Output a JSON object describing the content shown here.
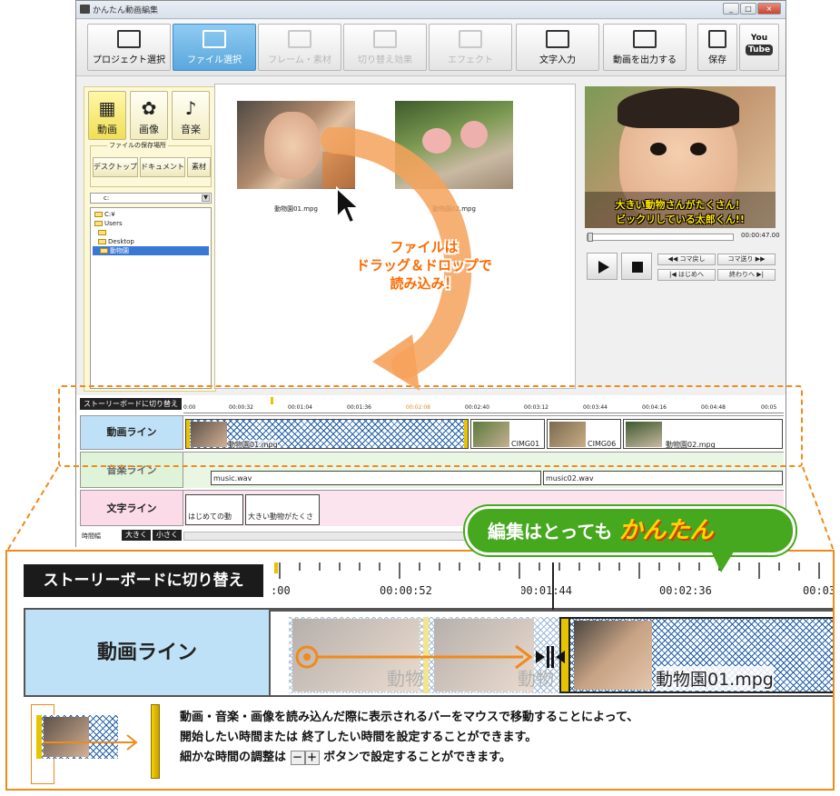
{
  "window": {
    "title": "かんたん動画編集",
    "controls": [
      "_",
      "□",
      "×"
    ]
  },
  "toolbar": {
    "project": "プロジェクト選択",
    "file": "ファイル選択",
    "frame": "フレーム・素材",
    "transition": "切り替え効果",
    "effect": "エフェクト",
    "text": "文字入力",
    "export": "動画を出力する",
    "save": "保存",
    "youtube_top": "You",
    "youtube_bottom": "Tube"
  },
  "media_tabs": {
    "video": "動画",
    "image": "画像",
    "music": "音楽"
  },
  "file_location": {
    "caption": "ファイルの保存場所",
    "desktop": "デスクトップ",
    "documents": "ドキュメント",
    "material": "素材",
    "drive": "c:"
  },
  "tree": [
    "C:¥",
    "Users",
    "",
    "Desktop",
    "動物園"
  ],
  "thumbnails": [
    {
      "caption": "動物園01.mpg"
    },
    {
      "caption": "動物園02.mpg"
    }
  ],
  "preview": {
    "subtitle_line1": "大きい動物さんがたくさん！",
    "subtitle_line2": "ビックリしている太郎くん!!",
    "timecode": "00:00:47.00",
    "prev_frame": "◀◀ コマ戻し",
    "next_frame": "コマ送り ▶▶",
    "to_start": "|◀ はじめへ",
    "to_end": "終わりへ ▶|",
    "play_progress": 0.0
  },
  "timeline": {
    "storyboard_button": "ストーリーボードに切り替え",
    "ruler_labels": [
      "0:00",
      "00:00:32",
      "00:01:04",
      "00:01:36",
      "00:02:08",
      "00:02:40",
      "00:03:12",
      "00:03:44",
      "00:04:16",
      "00:04:48",
      "00:05"
    ],
    "tracks": {
      "video": "動画ライン",
      "music": "音楽ライン",
      "text": "文字ライン"
    },
    "video_clips": [
      "動物園01.mpg",
      "CIMG01",
      "CIMG06",
      "動物園02.mpg"
    ],
    "music_clips": [
      "music.wav",
      "music02.wav"
    ],
    "text_clips": [
      "はじめての動",
      "大きい動物がたくさ"
    ],
    "zoom_label": "時間幅",
    "zoom_in": "大きく",
    "zoom_out": "小さく"
  },
  "callouts": {
    "drag_line1": "ファイルは",
    "drag_line2": "ドラッグ＆ドロップで",
    "drag_line3": "読み込み！",
    "bubble_text": "編集はとっても",
    "bubble_highlight": "かんたん"
  },
  "zoom": {
    "storyboard_button": "ストーリーボードに切り替え",
    "ruler_labels": [
      ":00",
      "00:00:52",
      "00:01:44",
      "00:02:36",
      "00:03"
    ],
    "track_label": "動画ライン",
    "clip_ghost": "動物",
    "clip_name": "動物園01.mpg",
    "desc_line1": "動画・音楽・画像を読み込んだ際に表示されるバーをマウスで移動することによって、",
    "desc_line2": "開始したい時間または 終了したい時間を設定することができます。",
    "desc_line3_a": "細かな時間の調整は",
    "minus": "－",
    "plus": "＋",
    "desc_line3_b": "ボタンで設定することができます。"
  },
  "colors": {
    "accent": "#f08a1a",
    "active_tab": "#5aa7dd",
    "bubble": "#46a81e",
    "drag_text": "#ff6a00"
  }
}
